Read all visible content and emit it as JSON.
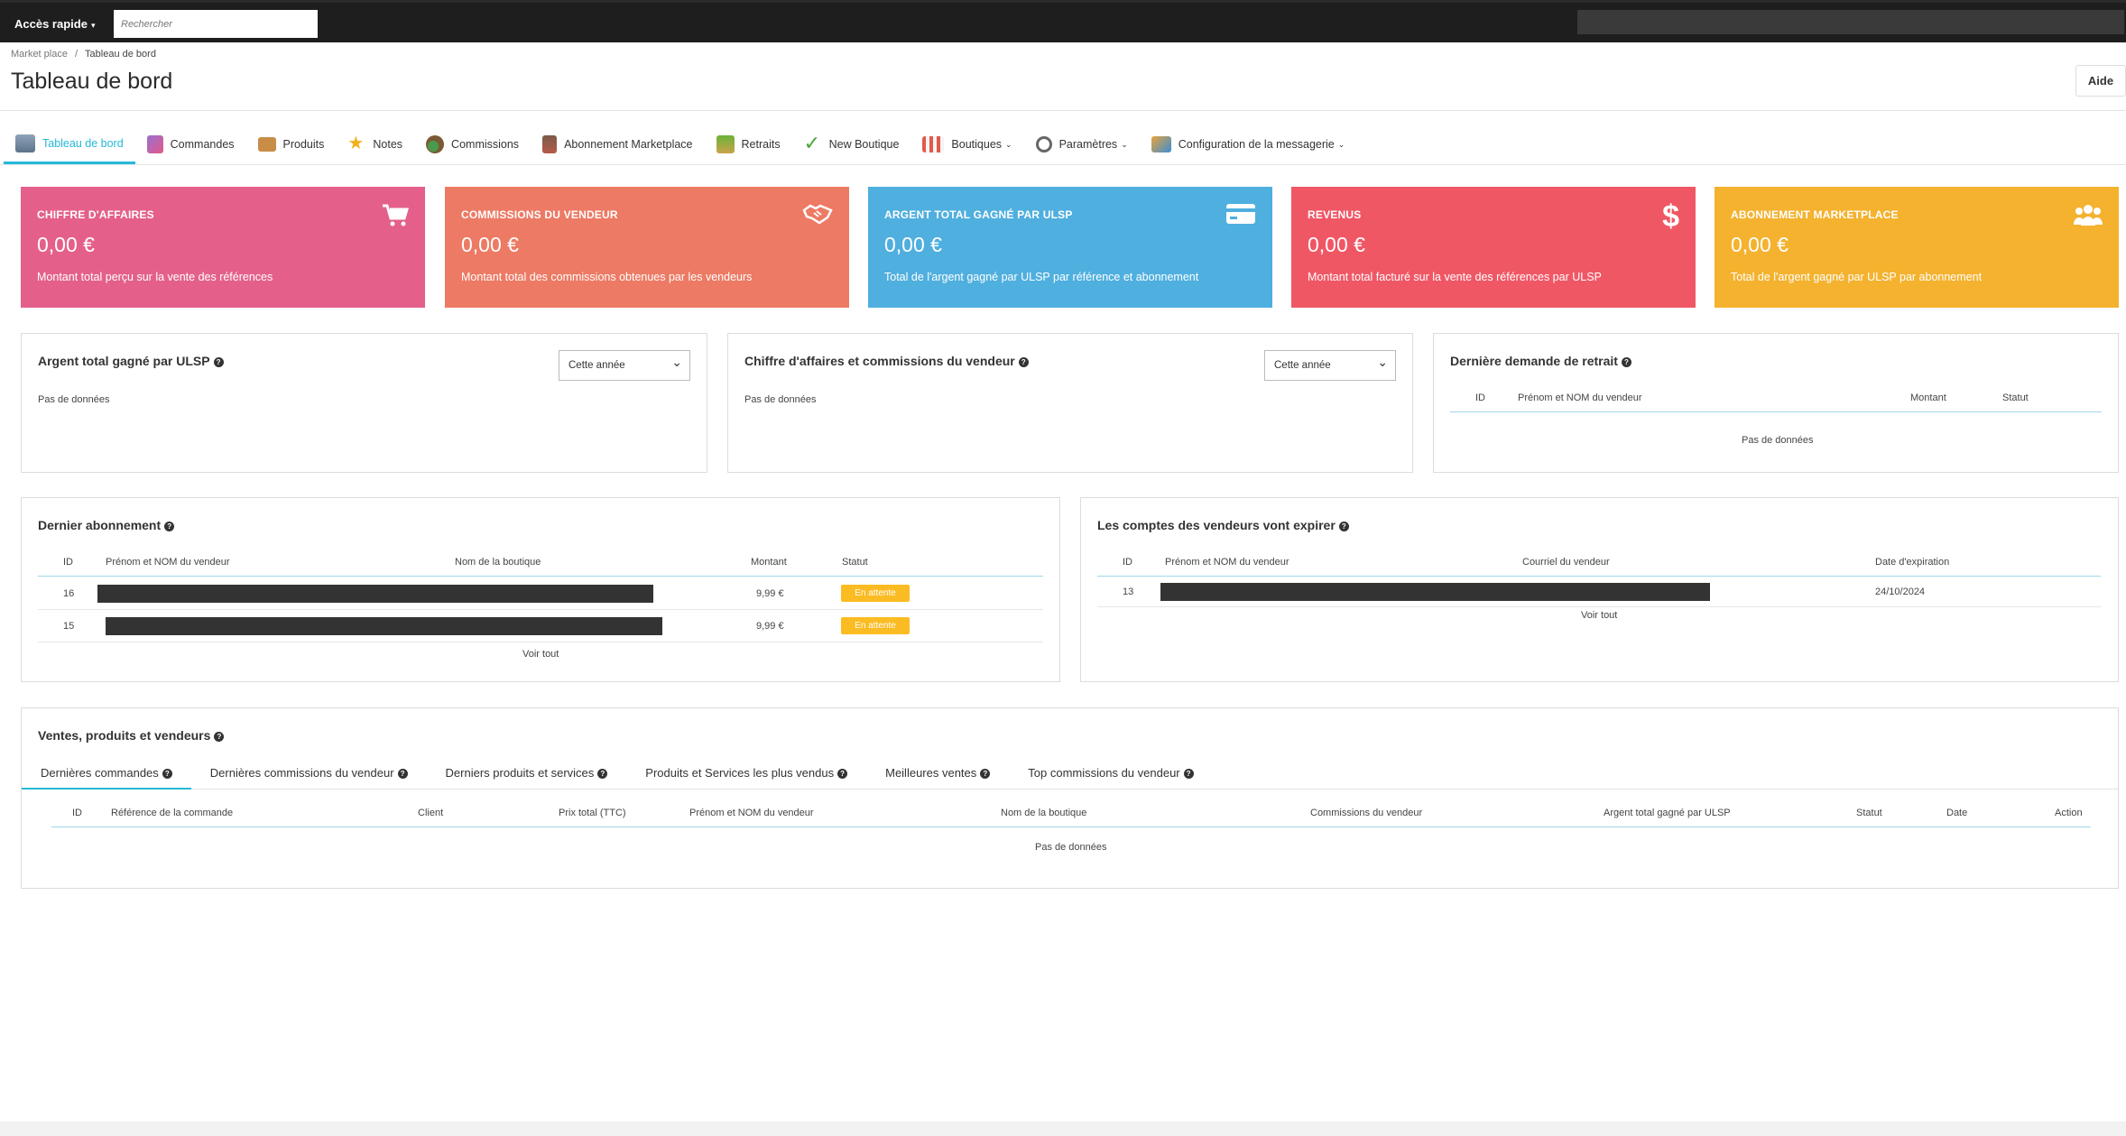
{
  "topbar": {
    "quick_access_label": "Accès rapide",
    "search_placeholder": "Rechercher"
  },
  "breadcrumb": {
    "parent": "Market place",
    "separator": "/",
    "current": "Tableau de bord"
  },
  "page_title": "Tableau de bord",
  "help_label": "Aide",
  "nav": [
    {
      "label": "Tableau de bord",
      "icon": "dashboard-icon",
      "active": true
    },
    {
      "label": "Commandes",
      "icon": "cart-icon"
    },
    {
      "label": "Produits",
      "icon": "box-icon"
    },
    {
      "label": "Notes",
      "icon": "star-icon"
    },
    {
      "label": "Commissions",
      "icon": "coins-icon"
    },
    {
      "label": "Abonnement Marketplace",
      "icon": "building-icon"
    },
    {
      "label": "Retraits",
      "icon": "money-hand-icon"
    },
    {
      "label": "New Boutique",
      "icon": "check-icon"
    },
    {
      "label": "Boutiques",
      "icon": "shop-icon",
      "dropdown": true
    },
    {
      "label": "Paramètres",
      "icon": "gears-icon",
      "dropdown": true
    },
    {
      "label": "Configuration de la messagerie",
      "icon": "messaging-icon",
      "dropdown": true
    }
  ],
  "kpis": [
    {
      "title": "CHIFFRE D'AFFAIRES",
      "value": "0,00 €",
      "desc": "Montant total perçu sur la vente des références",
      "color": "#e4608b",
      "icon": "cart-icon"
    },
    {
      "title": "COMMISSIONS DU VENDEUR",
      "value": "0,00 €",
      "desc": "Montant total des commissions obtenues par les vendeurs",
      "color": "#ed7a64",
      "icon": "handshake-icon"
    },
    {
      "title": "ARGENT TOTAL GAGNÉ PAR ULSP",
      "value": "0,00 €",
      "desc": "Total de l'argent gagné par ULSP par référence et abonnement",
      "color": "#4fafdf",
      "icon": "credit-card-icon"
    },
    {
      "title": "REVENUS",
      "value": "0,00 €",
      "desc": "Montant total facturé sur la vente des références par ULSP",
      "color": "#f05765",
      "icon": "dollar-icon"
    },
    {
      "title": "ABONNEMENT MARKETPLACE",
      "value": "0,00 €",
      "desc": "Total de l'argent gagné par ULSP par abonnement",
      "color": "#f4b22f",
      "icon": "users-icon"
    }
  ],
  "panel_ulsp": {
    "title": "Argent total gagné par ULSP",
    "select": "Cette année",
    "nodata": "Pas de données"
  },
  "panel_ca": {
    "title": "Chiffre d'affaires et commissions du vendeur",
    "select": "Cette année",
    "nodata": "Pas de données"
  },
  "panel_withdraw": {
    "title": "Dernière demande de retrait",
    "columns": [
      "ID",
      "Prénom et NOM du vendeur",
      "Montant",
      "Statut"
    ],
    "nodata": "Pas de données"
  },
  "panel_sub": {
    "title": "Dernier abonnement",
    "columns": [
      "ID",
      "Prénom et NOM du vendeur",
      "Nom de la boutique",
      "Montant",
      "Statut"
    ],
    "rows": [
      {
        "id": "16",
        "amount": "9,99 €",
        "status": "En attente"
      },
      {
        "id": "15",
        "amount": "9,99 €",
        "status": "En attente"
      }
    ],
    "see_all": "Voir tout"
  },
  "panel_expire": {
    "title": "Les comptes des vendeurs vont expirer",
    "columns": [
      "ID",
      "Prénom et NOM du vendeur",
      "Courriel du vendeur",
      "Date d'expiration"
    ],
    "rows": [
      {
        "id": "13",
        "date": "24/10/2024"
      }
    ],
    "see_all": "Voir tout"
  },
  "panel_sales": {
    "title": "Ventes, produits et vendeurs",
    "tabs": [
      {
        "label": "Dernières commandes",
        "active": true
      },
      {
        "label": "Dernières commissions du vendeur"
      },
      {
        "label": "Derniers produits et services"
      },
      {
        "label": "Produits et Services les plus vendus"
      },
      {
        "label": "Meilleures ventes"
      },
      {
        "label": "Top commissions du vendeur"
      }
    ],
    "columns": [
      "ID",
      "Référence de la commande",
      "Client",
      "Prix total (TTC)",
      "Prénom et NOM du vendeur",
      "Nom de la boutique",
      "Commissions du vendeur",
      "Argent total gagné par ULSP",
      "Statut",
      "Date",
      "Action"
    ],
    "nodata": "Pas de données"
  }
}
